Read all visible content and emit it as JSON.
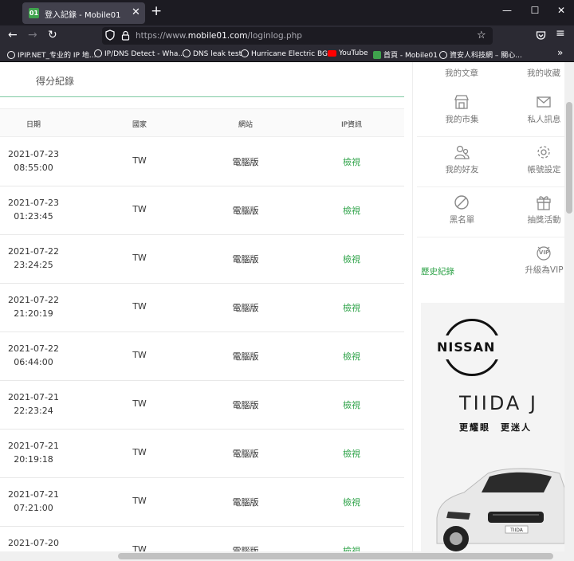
{
  "browser": {
    "tab_title": "登入記錄 - Mobile01",
    "tab_favicon": "01",
    "url_prefix": "https://www.",
    "url_domain": "mobile01.com",
    "url_path": "/loginlog.php",
    "bookmarks": [
      "IPIP.NET_专业的 IP 地...",
      "IP/DNS Detect - Wha...",
      "DNS leak test",
      "Hurricane Electric BG...",
      "YouTube",
      "首頁 - Mobile01",
      "資安人科技網 – 關心..."
    ],
    "bookmark_overflow": "»"
  },
  "main": {
    "tab_label": "得分紀錄",
    "headers": [
      "日期",
      "國家",
      "網站",
      "IP資訊"
    ],
    "rows": [
      {
        "date": "2021-07-23",
        "time": "08:55:00",
        "country": "TW",
        "site": "電腦版",
        "ip": "檢視"
      },
      {
        "date": "2021-07-23",
        "time": "01:23:45",
        "country": "TW",
        "site": "電腦版",
        "ip": "檢視"
      },
      {
        "date": "2021-07-22",
        "time": "23:24:25",
        "country": "TW",
        "site": "電腦版",
        "ip": "檢視"
      },
      {
        "date": "2021-07-22",
        "time": "21:20:19",
        "country": "TW",
        "site": "電腦版",
        "ip": "檢視"
      },
      {
        "date": "2021-07-22",
        "time": "06:44:00",
        "country": "TW",
        "site": "電腦版",
        "ip": "檢視"
      },
      {
        "date": "2021-07-21",
        "time": "22:23:24",
        "country": "TW",
        "site": "電腦版",
        "ip": "檢視"
      },
      {
        "date": "2021-07-21",
        "time": "20:19:18",
        "country": "TW",
        "site": "電腦版",
        "ip": "檢視"
      },
      {
        "date": "2021-07-21",
        "time": "07:21:00",
        "country": "TW",
        "site": "電腦版",
        "ip": "檢視"
      },
      {
        "date": "2021-07-20",
        "time": "",
        "country": "TW",
        "site": "電腦版",
        "ip": "檢視"
      }
    ]
  },
  "sidebar": {
    "top": [
      "我的文章",
      "我的收藏"
    ],
    "items": [
      {
        "label": "我的市集",
        "icon": "store-icon"
      },
      {
        "label": "私人訊息",
        "icon": "envelope-icon"
      },
      {
        "label": "我的好友",
        "icon": "friends-icon"
      },
      {
        "label": "帳號設定",
        "icon": "gear-icon"
      },
      {
        "label": "黑名單",
        "icon": "block-icon"
      },
      {
        "label": "抽獎活動",
        "icon": "gift-icon"
      },
      {
        "label": "歷史紀錄",
        "icon": ""
      },
      {
        "label": "升級為VIP",
        "icon": "vip-icon"
      }
    ],
    "vip_badge": "VIP"
  },
  "ad": {
    "brand": "NISSAN",
    "model": "TIIDA J",
    "slogan": "更耀眼　更迷人",
    "plate": "TIIDA"
  },
  "colors": {
    "accent": "#2fa349",
    "tab_line": "#7fc9a3"
  }
}
